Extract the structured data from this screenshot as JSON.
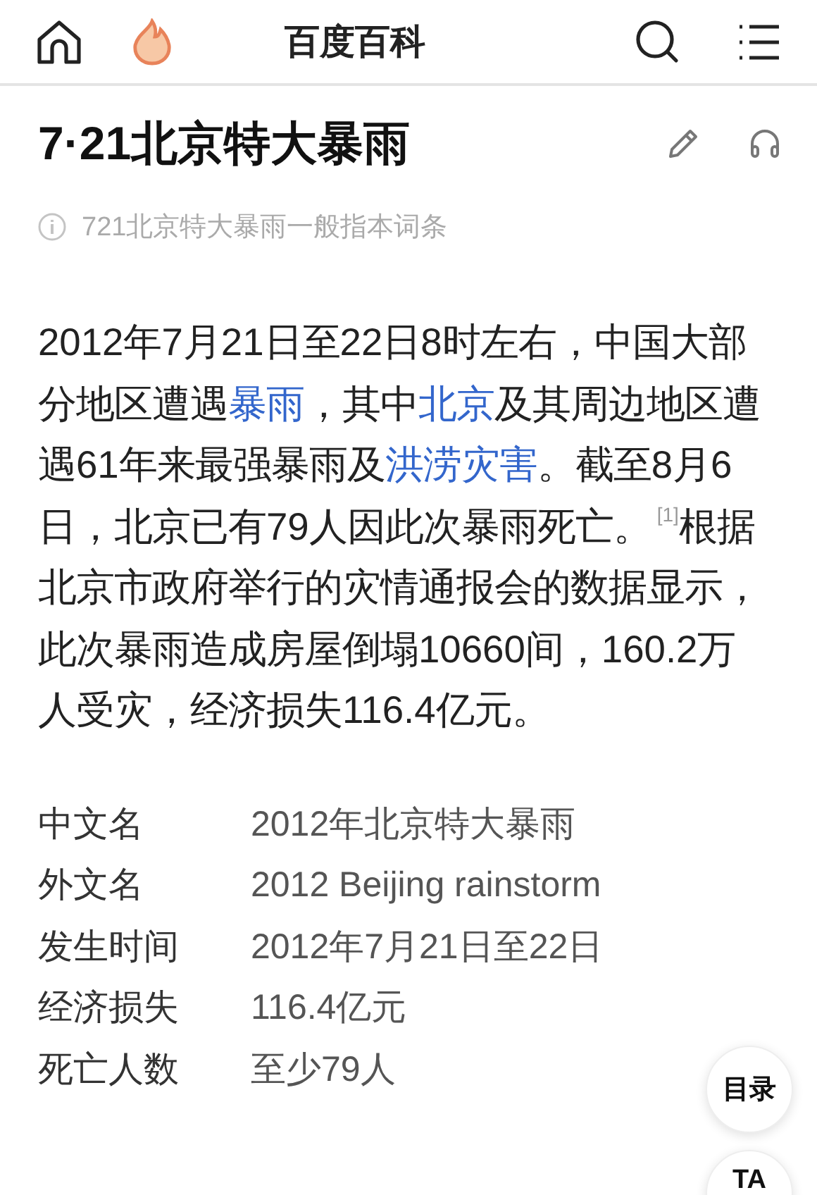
{
  "header": {
    "title": "百度百科"
  },
  "article": {
    "title": "7·21北京特大暴雨",
    "note": "721北京特大暴雨一般指本词条"
  },
  "summary": [
    {
      "kind": "plain",
      "text": "2012年7月21日至22日8时左右，中国大部分地区遭遇"
    },
    {
      "kind": "link",
      "text": "暴雨"
    },
    {
      "kind": "plain",
      "text": "，其中"
    },
    {
      "kind": "link",
      "text": "北京"
    },
    {
      "kind": "plain",
      "text": "及其周边地区遭遇61年来最强暴雨及"
    },
    {
      "kind": "link",
      "text": "洪涝灾害"
    },
    {
      "kind": "plain",
      "text": "。截至8月6日，北京已有79人因此次暴雨死亡。"
    },
    {
      "kind": "ref",
      "text": "[1]"
    },
    {
      "kind": "plain",
      "text": "根据北京市政府举行的灾情通报会的数据显示，此次暴雨造成房屋倒塌10660间，160.2万人受灾，经济损失116.4亿元。"
    }
  ],
  "infobox": [
    {
      "label": "中文名",
      "value": "2012年北京特大暴雨"
    },
    {
      "label": "外文名",
      "value": "2012 Beijing rainstorm"
    },
    {
      "label": "发生时间",
      "value": "2012年7月21日至22日"
    },
    {
      "label": "经济损失",
      "value": "116.4亿元"
    },
    {
      "label": "死亡人数",
      "value": "至少79人"
    }
  ],
  "floating_buttons": [
    "目录",
    "TA"
  ]
}
